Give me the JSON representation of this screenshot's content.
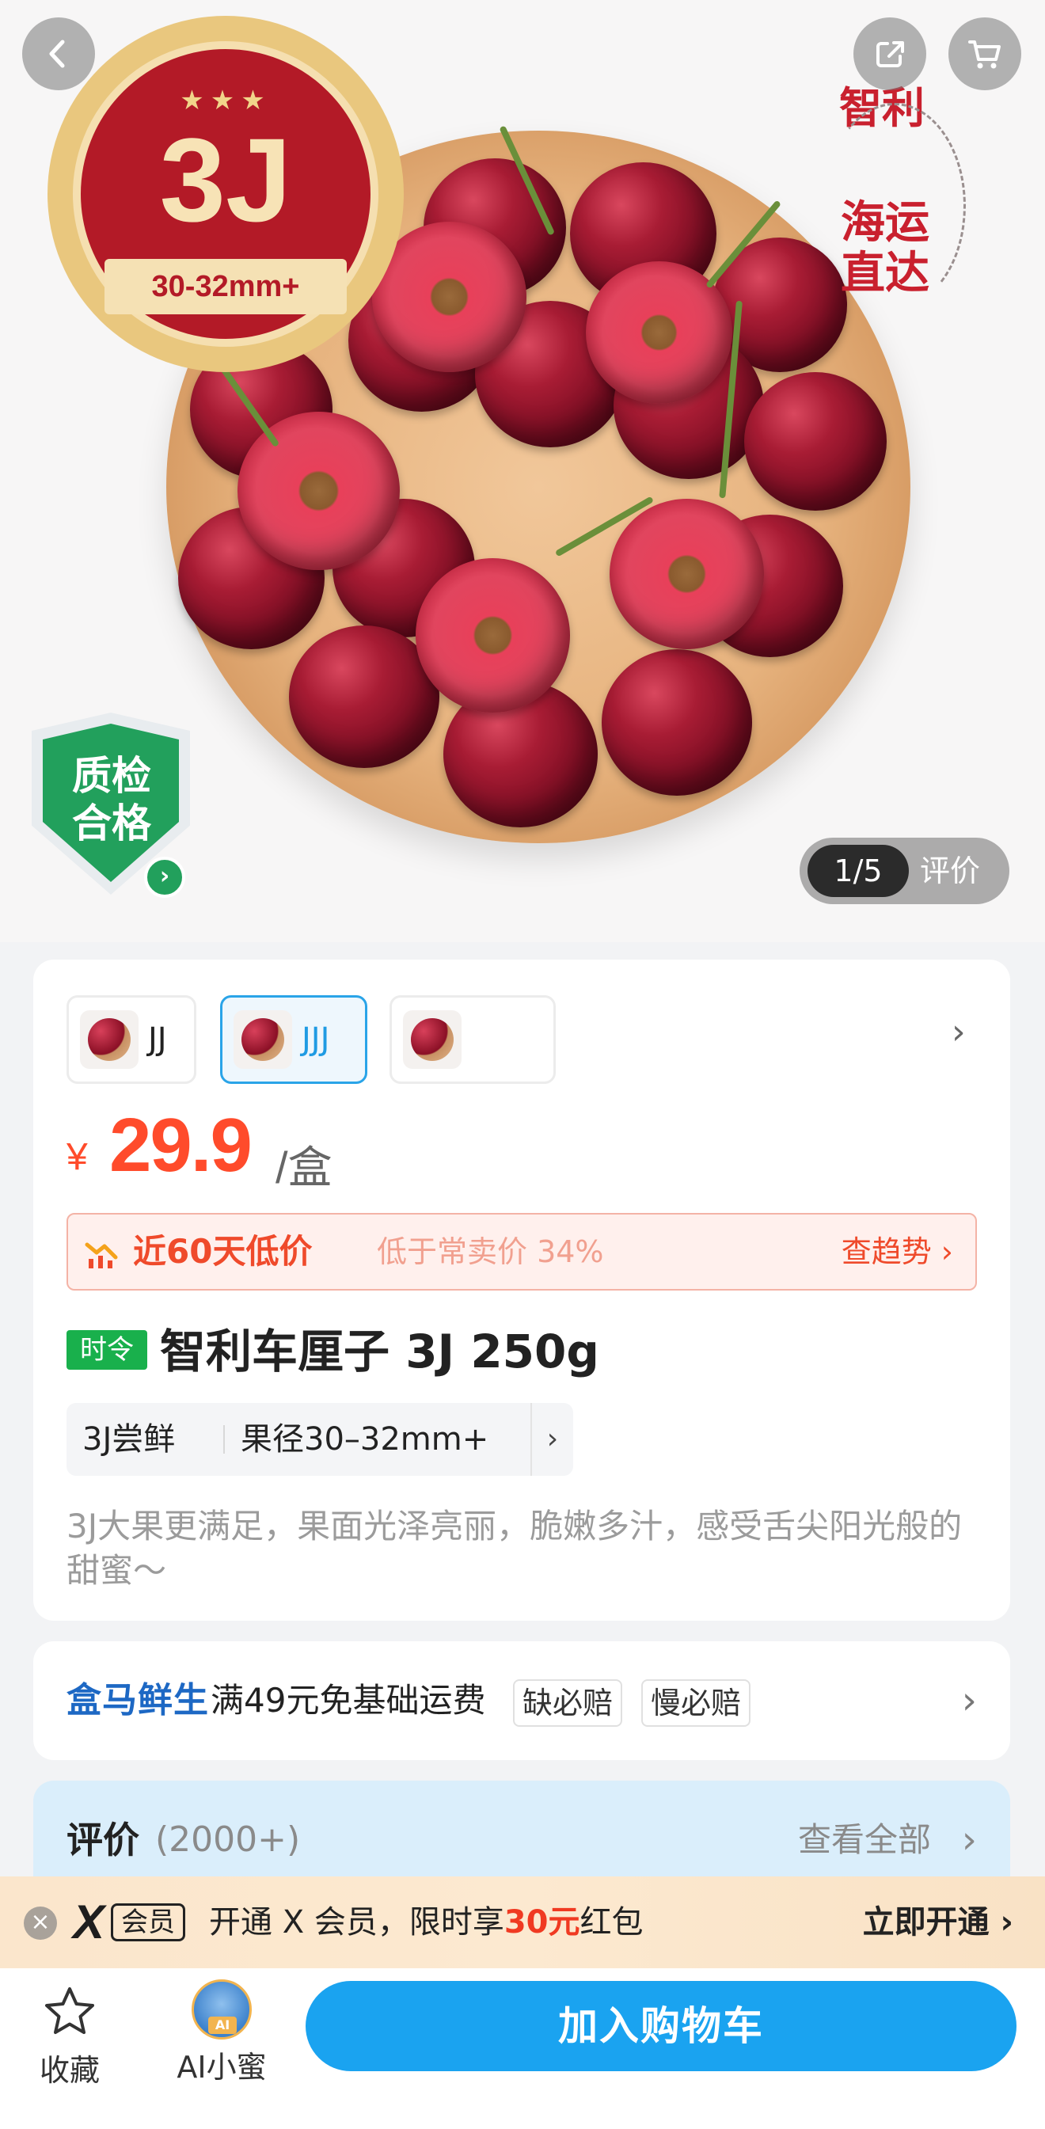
{
  "hero": {
    "badge_stars": "★★★",
    "badge_grade": "3J",
    "badge_size": "30-32mm+",
    "origin_label": "智利",
    "shipping_label": "海运直达",
    "qc_label": "质检合格",
    "pager_count": "1/5",
    "pager_review": "评价"
  },
  "sku": {
    "options": [
      {
        "label": "JJ",
        "selected": false
      },
      {
        "label": "JJJ",
        "selected": true
      },
      {
        "label": "",
        "selected": false
      }
    ]
  },
  "price": {
    "symbol": "¥",
    "amount": "29.9",
    "unit": "/盒"
  },
  "low_price": {
    "title": "近60天低价",
    "subtitle": "低于常卖价 34%",
    "trend": "查趋势 ›"
  },
  "product": {
    "tag": "时令",
    "title": "智利车厘子 3J 250g",
    "spec_a": "3J尝鲜",
    "spec_b": "果径30–32mm+",
    "description": "3J大果更满足，果面光泽亮丽，脆嫩多汁，感受舌尖阳光般的甜蜜～"
  },
  "shipping": {
    "brand": "盒马鲜生",
    "text": "满49元免基础运费",
    "tags": [
      "缺必赔",
      "慢必赔"
    ]
  },
  "reviews": {
    "title": "评价",
    "count": "(2000+)",
    "view_all": "查看全部"
  },
  "member": {
    "x_logo": "X",
    "vip_badge": "会员",
    "text_prefix": "开通 X 会员，限时享",
    "highlight": "30元",
    "text_suffix": "红包",
    "cta": "立即开通 ›"
  },
  "bottom_bar": {
    "favorite_label": "收藏",
    "ai_label": "AI小蜜",
    "ai_badge": "AI",
    "add_to_cart": "加入购物车"
  },
  "colors": {
    "accent_blue": "#1aa3f0",
    "price_red": "#ff4b2b",
    "tag_green": "#19b04c",
    "hema_blue": "#1d68c4"
  }
}
